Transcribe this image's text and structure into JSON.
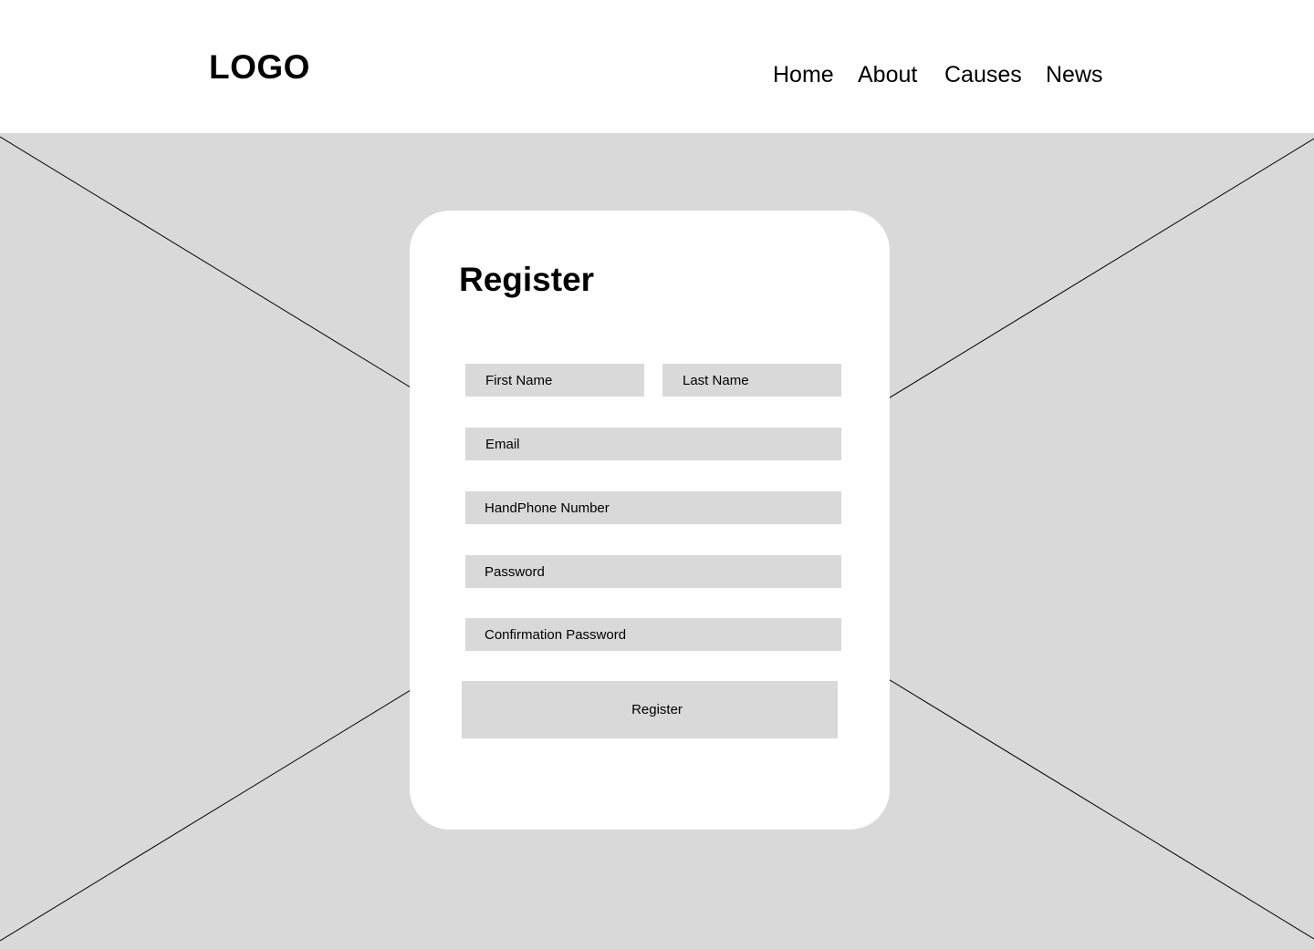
{
  "header": {
    "logo": "LOGO",
    "nav": [
      {
        "label": "Home"
      },
      {
        "label": "About"
      },
      {
        "label": "Causes"
      },
      {
        "label": "News"
      }
    ]
  },
  "form": {
    "title": "Register",
    "fields": {
      "first_name": {
        "placeholder": "First Name",
        "value": ""
      },
      "last_name": {
        "placeholder": "Last Name",
        "value": ""
      },
      "email": {
        "placeholder": "Email",
        "value": ""
      },
      "phone": {
        "placeholder": "HandPhone Number",
        "value": ""
      },
      "password": {
        "placeholder": "Password",
        "value": ""
      },
      "confirm_password": {
        "placeholder": "Confirmation Password",
        "value": ""
      }
    },
    "submit_label": "Register"
  },
  "colors": {
    "background": "#d9d9d9",
    "surface": "#ffffff",
    "text": "#000000"
  }
}
